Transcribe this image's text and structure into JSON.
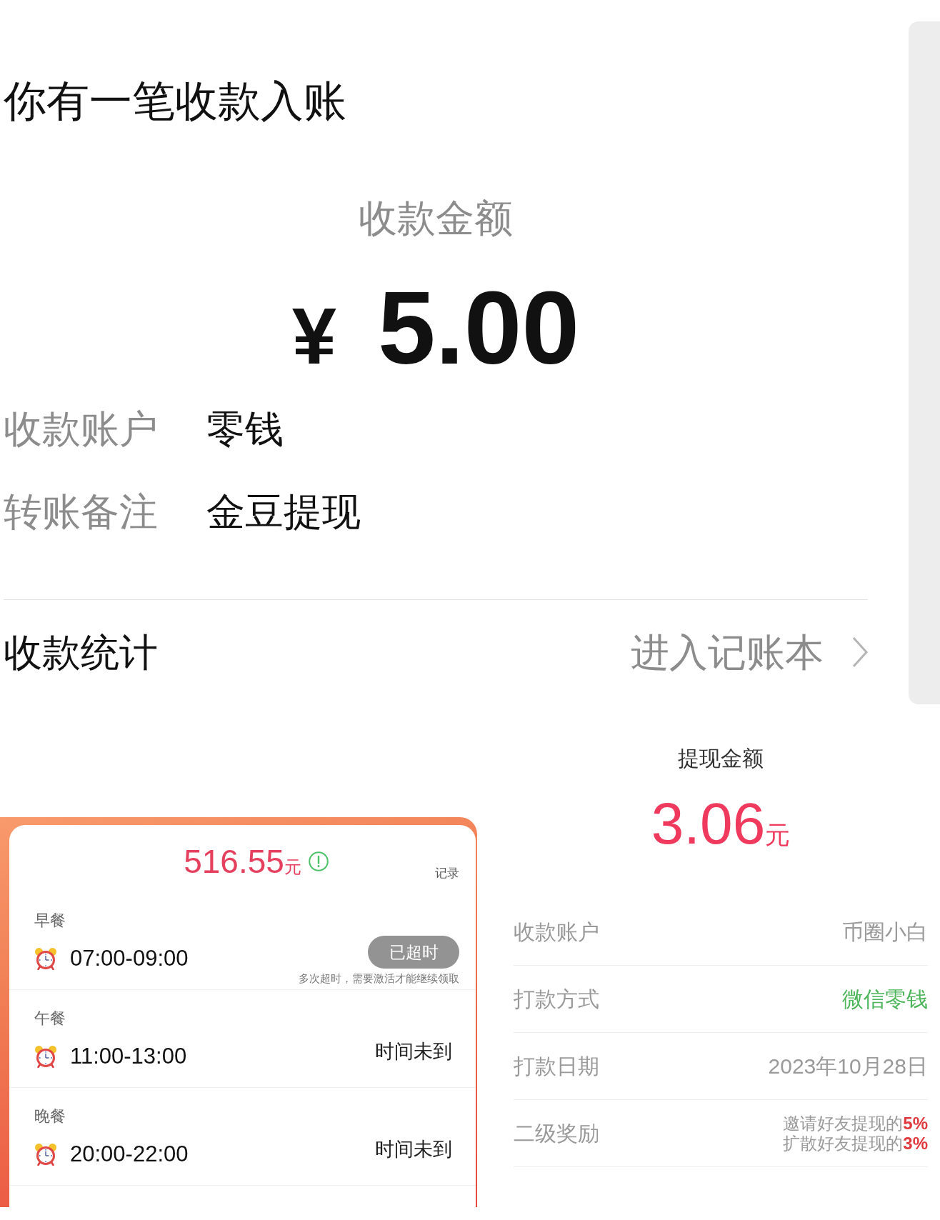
{
  "notice": {
    "title": "你有一笔收款入账",
    "amount_label": "收款金额",
    "currency": "¥",
    "amount": "5.00",
    "details": [
      {
        "label": "收款账户",
        "value": "零钱"
      },
      {
        "label": "转账备注",
        "value": "金豆提现"
      }
    ],
    "stats": {
      "label": "收款统计",
      "link": "进入记账本"
    }
  },
  "reward_card": {
    "balance": "516.55",
    "unit": "元",
    "records_link": "记录",
    "meals": [
      {
        "name": "早餐",
        "time": "07:00-09:00",
        "status": {
          "kind": "button",
          "label": "已超时",
          "disabled": true,
          "note": "多次超时，需要激活才能继续领取"
        }
      },
      {
        "name": "午餐",
        "time": "11:00-13:00",
        "status": {
          "kind": "text",
          "label": "时间未到"
        }
      },
      {
        "name": "晚餐",
        "time": "20:00-22:00",
        "status": {
          "kind": "text",
          "label": "时间未到"
        }
      }
    ]
  },
  "withdrawal": {
    "title": "提现金额",
    "amount": "3.06",
    "unit": "元",
    "rows": [
      {
        "kind": "plain",
        "label": "收款账户",
        "value": "币圈小白"
      },
      {
        "kind": "accent",
        "label": "打款方式",
        "value": "微信零钱"
      },
      {
        "kind": "plain",
        "label": "打款日期",
        "value": "2023年10月28日"
      },
      {
        "kind": "lines",
        "label": "二级奖励",
        "lines": [
          "邀请好友提现的**5%**",
          "扩散好友提现的**3%**"
        ]
      }
    ]
  }
}
